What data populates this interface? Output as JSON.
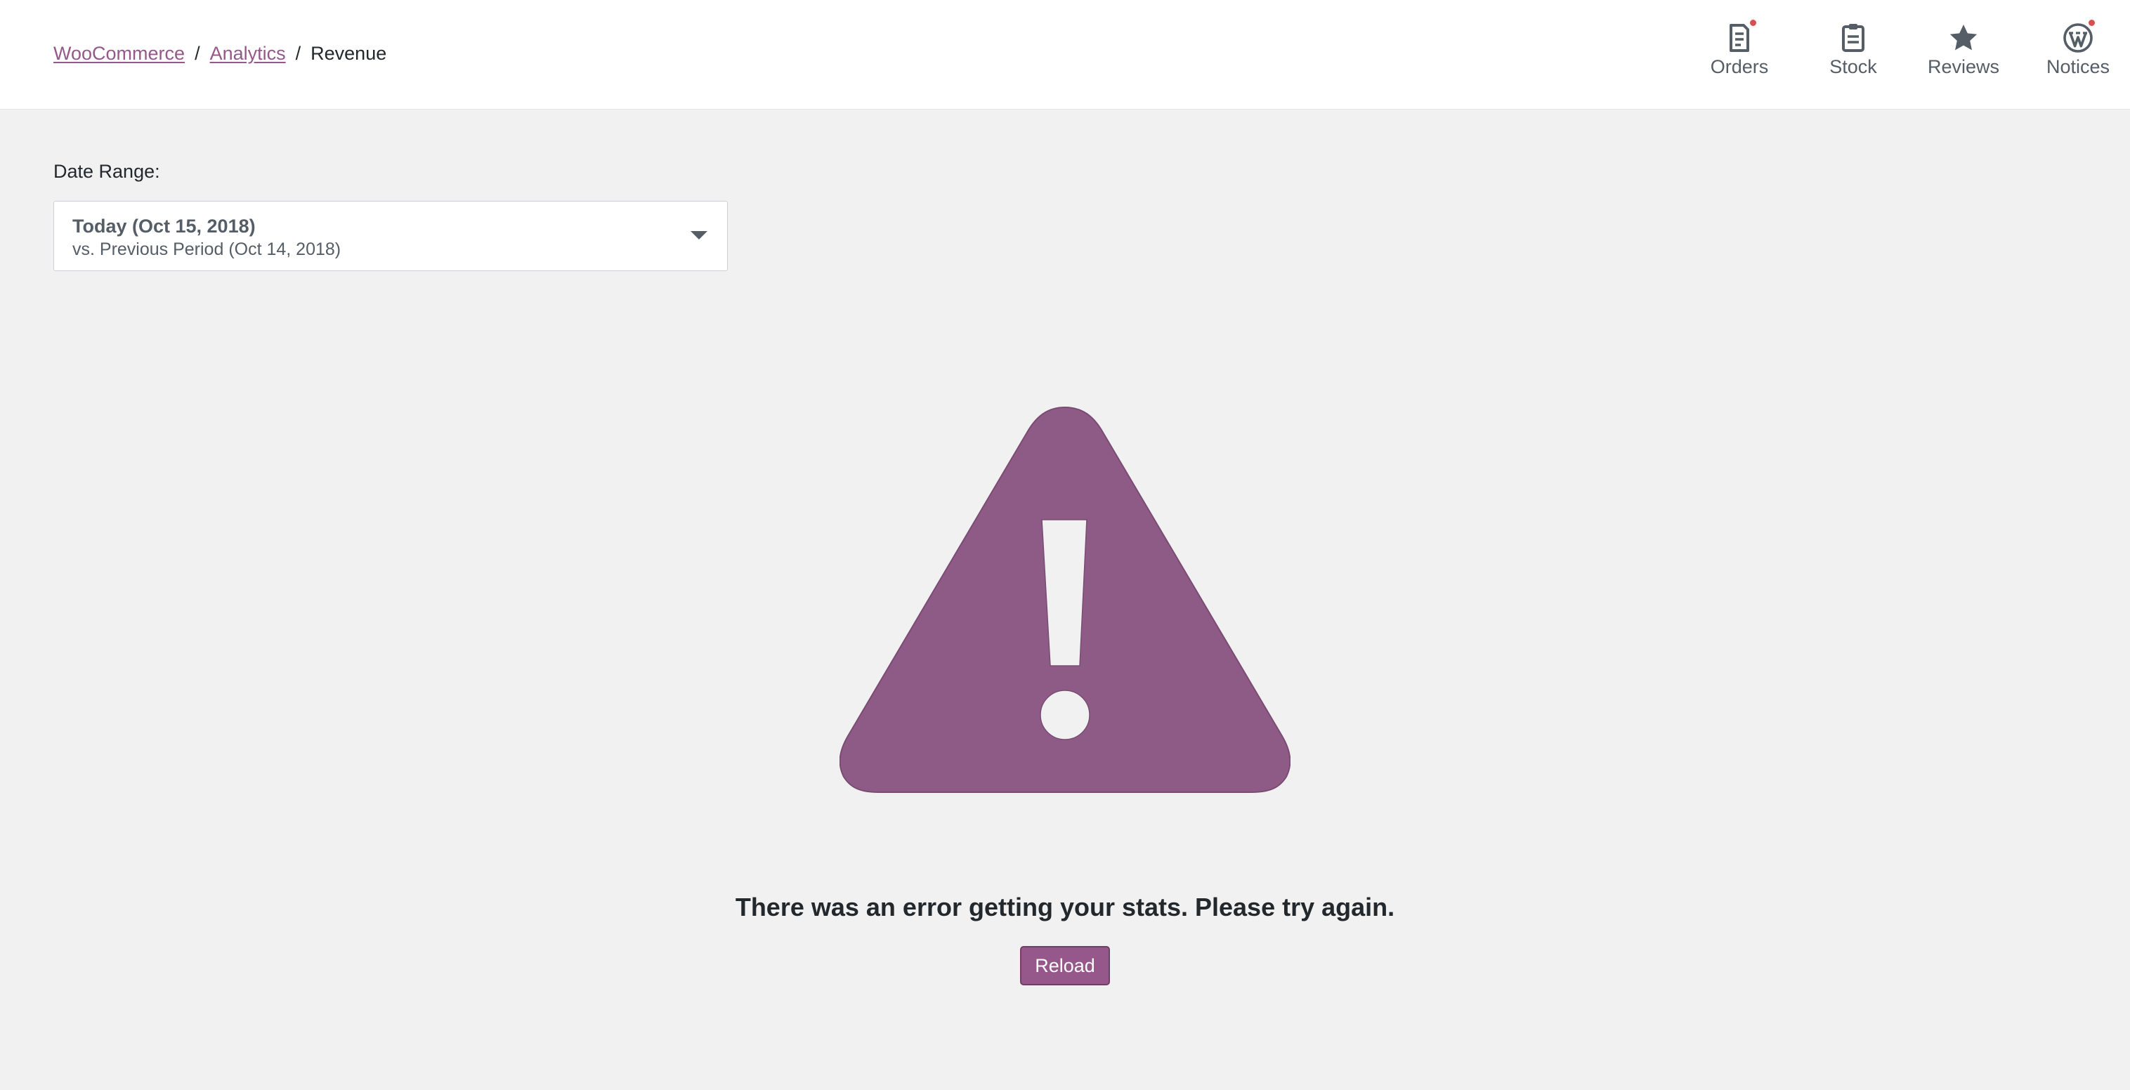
{
  "breadcrumb": {
    "items": [
      "WooCommerce",
      "Analytics",
      "Revenue"
    ],
    "separator": "/"
  },
  "activity_panel": {
    "items": [
      {
        "label": "Orders",
        "icon": "orders-icon",
        "has_notification": true
      },
      {
        "label": "Stock",
        "icon": "clipboard-icon",
        "has_notification": false
      },
      {
        "label": "Reviews",
        "icon": "star-icon",
        "has_notification": false
      },
      {
        "label": "Notices",
        "icon": "wordpress-icon",
        "has_notification": true
      }
    ],
    "notification_color": "#d94f4f"
  },
  "date_range": {
    "label": "Date Range:",
    "primary": "Today (Oct 15, 2018)",
    "secondary": "vs. Previous Period (Oct 14, 2018)"
  },
  "error": {
    "icon": "warning-icon",
    "message": "There was an error getting your stats. Please try again.",
    "reload_label": "Reload"
  },
  "colors": {
    "brand": "#96588a",
    "background": "#f1f1f1",
    "text": "#23282d"
  }
}
